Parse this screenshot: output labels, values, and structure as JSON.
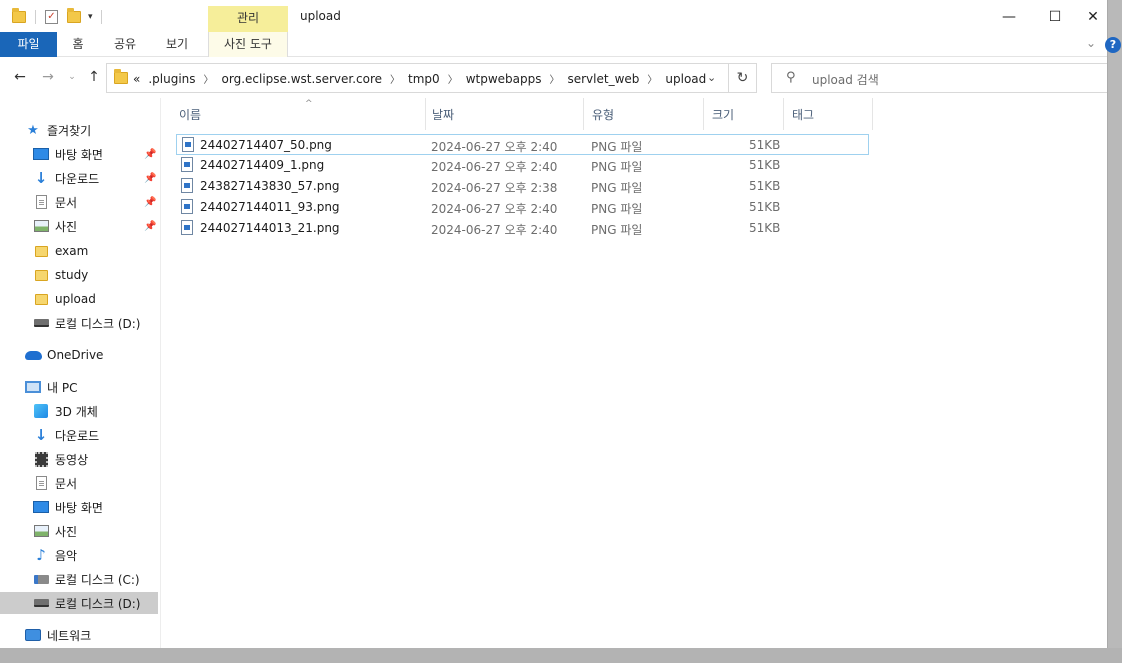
{
  "window": {
    "title": "upload",
    "context_group": "관리",
    "controls": {
      "minimize": "—",
      "maximize": "☐",
      "close": "✕"
    }
  },
  "ribbon": {
    "file_tab": "파일",
    "tabs": [
      "홈",
      "공유",
      "보기"
    ],
    "context_tab": "사진 도구",
    "help": "?"
  },
  "address": {
    "overflow": "«",
    "crumbs": [
      ".plugins",
      "org.eclipse.wst.server.core",
      "tmp0",
      "wtpwebapps",
      "servlet_web",
      "upload"
    ]
  },
  "search": {
    "placeholder": "upload 검색"
  },
  "nav": {
    "quick_access": "즐겨찾기",
    "quick_items": [
      "바탕 화면",
      "다운로드",
      "문서",
      "사진",
      "exam",
      "study",
      "upload",
      "로컬 디스크 (D:)"
    ],
    "onedrive": "OneDrive",
    "this_pc": "내 PC",
    "pc_items": [
      "3D 개체",
      "다운로드",
      "동영상",
      "문서",
      "바탕 화면",
      "사진",
      "음악",
      "로컬 디스크 (C:)",
      "로컬 디스크 (D:)"
    ],
    "network": "네트워크"
  },
  "columns": {
    "name": "이름",
    "date": "날짜",
    "type": "유형",
    "size": "크기",
    "tags": "태그"
  },
  "files": [
    {
      "name": "24402714407_50.png",
      "date": "2024-06-27 오후 2:40",
      "type": "PNG 파일",
      "size": "51KB"
    },
    {
      "name": "24402714409_1.png",
      "date": "2024-06-27 오후 2:40",
      "type": "PNG 파일",
      "size": "51KB"
    },
    {
      "name": "243827143830_57.png",
      "date": "2024-06-27 오후 2:38",
      "type": "PNG 파일",
      "size": "51KB"
    },
    {
      "name": "244027144011_93.png",
      "date": "2024-06-27 오후 2:40",
      "type": "PNG 파일",
      "size": "51KB"
    },
    {
      "name": "244027144013_21.png",
      "date": "2024-06-27 오후 2:40",
      "type": "PNG 파일",
      "size": "51KB"
    }
  ],
  "colors": {
    "accent": "#1a66b8",
    "context_tab": "#f6ee9a",
    "selection": "#cccccc",
    "focus_border": "#9fd1ef"
  }
}
